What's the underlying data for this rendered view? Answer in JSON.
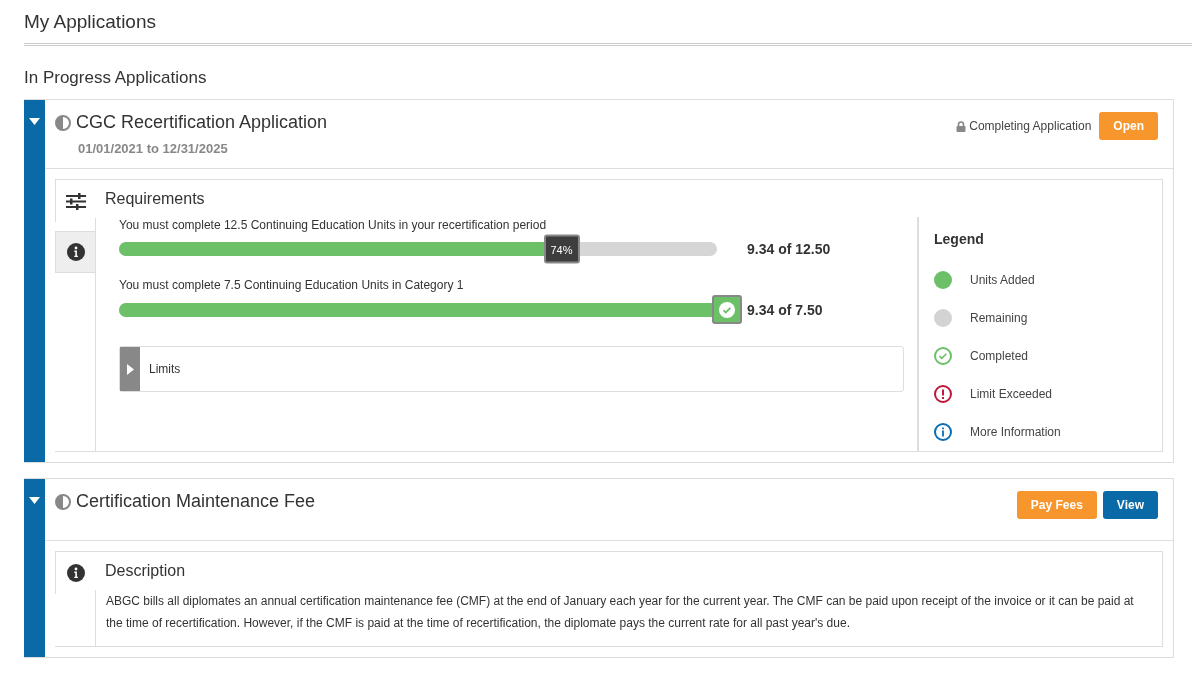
{
  "page": {
    "title": "My Applications"
  },
  "section": {
    "title": "In Progress Applications"
  },
  "applications": [
    {
      "title": "CGC Recertification Application",
      "dates": "01/01/2021 to 12/31/2025",
      "expanded": true,
      "status": {
        "text": "Completing Application",
        "locked": true
      },
      "buttons": [
        {
          "label": "Open",
          "kind": "orange"
        }
      ],
      "tabs": [
        {
          "kind": "sliders",
          "selected": true
        },
        {
          "kind": "info",
          "selected": false
        }
      ],
      "panel": {
        "kind": "requirements",
        "title": "Requirements",
        "requirements": [
          {
            "text": "You must complete 12.5 Continuing Education Units in your recertification period",
            "level": 0.74,
            "badge": {
              "kind": "percent",
              "label": "74%"
            },
            "reading": "9.34 of 12.50"
          },
          {
            "text": "You must complete 7.5 Continuing Education Units in Category 1",
            "level": 1,
            "badge": {
              "kind": "complete"
            },
            "reading": "9.34 of 7.50"
          }
        ],
        "limits": {
          "label": "Limits",
          "expanded": false
        },
        "legend": {
          "title": "Legend",
          "items": [
            {
              "kind": "dot",
              "color": "#6cc067",
              "label": "Units Added"
            },
            {
              "kind": "dot",
              "color": "#d3d3d3",
              "label": "Remaining"
            },
            {
              "kind": "check",
              "color": "#6cc067",
              "label": "Completed"
            },
            {
              "kind": "alert",
              "color": "#c0183a",
              "label": "Limit Exceeded"
            },
            {
              "kind": "info",
              "color": "#0a6eb4",
              "label": "More Information"
            }
          ]
        }
      }
    },
    {
      "title": "Certification Maintenance Fee",
      "expanded": true,
      "buttons": [
        {
          "label": "Pay Fees",
          "kind": "orange"
        },
        {
          "label": "View",
          "kind": "blue"
        }
      ],
      "tabs": [
        {
          "kind": "info",
          "selected": true
        }
      ],
      "panel": {
        "kind": "description",
        "title": "Description",
        "text": "ABGC bills all diplomates an annual certification maintenance fee (CMF) at the end of January each year for the current year. The CMF can be paid upon receipt of the invoice or it can be paid at the time of recertification. However, if the CMF is paid at the time of recertification, the diplomate pays the current rate for all past year's due."
      }
    }
  ]
}
